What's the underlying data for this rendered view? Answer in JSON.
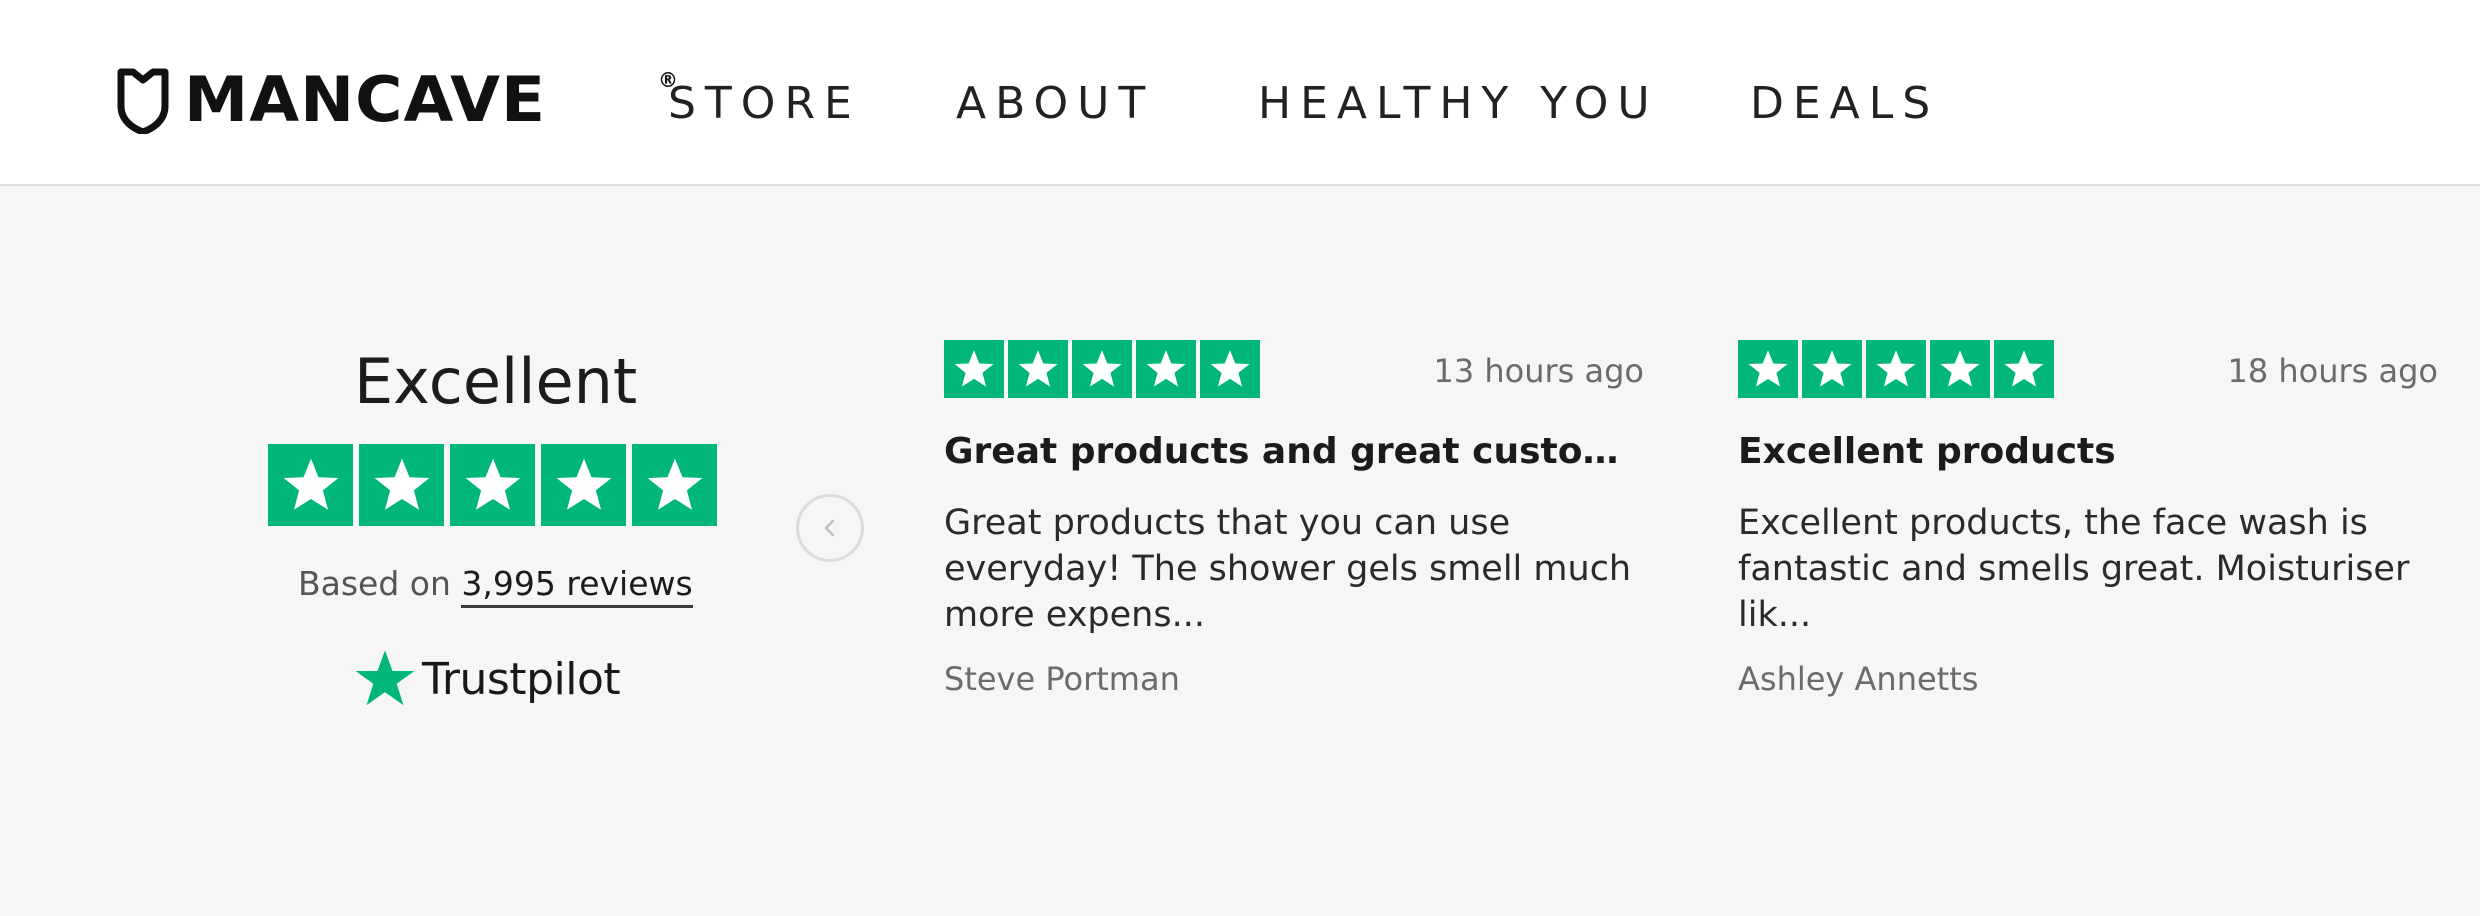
{
  "header": {
    "logo_text": "MANCAVE",
    "logo_reg": "®",
    "nav": [
      "STORE",
      "ABOUT",
      "HEALTHY YOU",
      "DEALS"
    ]
  },
  "summary": {
    "rating_label": "Excellent",
    "stars": 5,
    "based_on_prefix": "Based on",
    "reviews_link": "3,995 reviews",
    "brand": "Trustpilot",
    "brand_color": "#00b67a"
  },
  "reviews": [
    {
      "stars": 5,
      "time": "13 hours ago",
      "title": "Great products and great customer...",
      "body": "Great products that you can use everyday! The shower gels smell much more expens...",
      "author": "Steve Portman"
    },
    {
      "stars": 5,
      "time": "18 hours ago",
      "title": "Excellent products",
      "body": "Excellent products, the face wash is fantastic and smells great. Moisturiser lik...",
      "author": "Ashley Annetts"
    }
  ],
  "icons": {
    "logo": "shield-icon",
    "star": "star-icon",
    "prev": "chevron-left-icon"
  }
}
